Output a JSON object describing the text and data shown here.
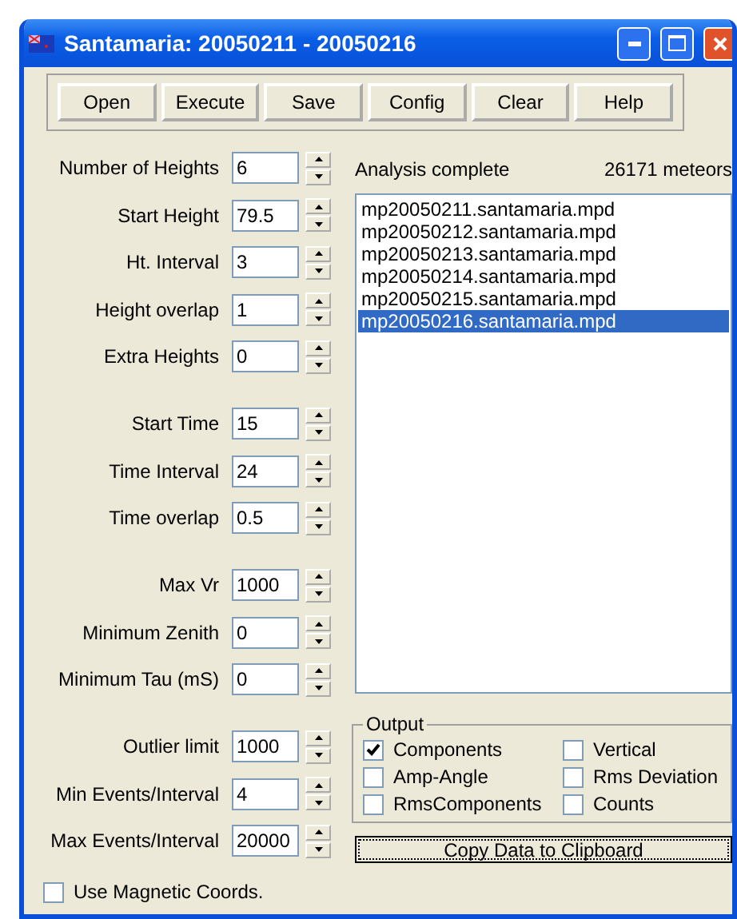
{
  "window": {
    "title": "Santamaria: 20050211 - 20050216"
  },
  "toolbar": [
    "Open",
    "Execute",
    "Save",
    "Config",
    "Clear",
    "Help"
  ],
  "parameter_groups": [
    [
      {
        "label": "Number of Heights",
        "value": "6"
      },
      {
        "label": "Start Height",
        "value": "79.5"
      },
      {
        "label": "Ht. Interval",
        "value": "3"
      },
      {
        "label": "Height overlap",
        "value": "1"
      },
      {
        "label": "Extra Heights",
        "value": "0"
      }
    ],
    [
      {
        "label": "Start Time",
        "value": "15"
      },
      {
        "label": "Time Interval",
        "value": "24"
      },
      {
        "label": "Time overlap",
        "value": "0.5"
      }
    ],
    [
      {
        "label": "Max Vr",
        "value": "1000"
      },
      {
        "label": "Minimum Zenith",
        "value": "0"
      },
      {
        "label": "Minimum Tau (mS)",
        "value": "0"
      }
    ],
    [
      {
        "label": "Outlier limit",
        "value": "1000"
      },
      {
        "label": "Min Events/Interval",
        "value": "4"
      },
      {
        "label": "Max Events/Interval",
        "value": "20000"
      }
    ]
  ],
  "use_magnetic_coords": {
    "label": "Use Magnetic Coords.",
    "checked": false
  },
  "status": {
    "message": "Analysis complete",
    "count": "26171 meteors"
  },
  "files": [
    {
      "name": "mp20050211.santamaria.mpd",
      "selected": false
    },
    {
      "name": "mp20050212.santamaria.mpd",
      "selected": false
    },
    {
      "name": "mp20050213.santamaria.mpd",
      "selected": false
    },
    {
      "name": "mp20050214.santamaria.mpd",
      "selected": false
    },
    {
      "name": "mp20050215.santamaria.mpd",
      "selected": false
    },
    {
      "name": "mp20050216.santamaria.mpd",
      "selected": true
    }
  ],
  "output": {
    "title": "Output",
    "options": [
      {
        "label": "Components",
        "checked": true
      },
      {
        "label": "Vertical",
        "checked": false
      },
      {
        "label": "Amp-Angle",
        "checked": false
      },
      {
        "label": "Rms Deviation",
        "checked": false
      },
      {
        "label": "RmsComponents",
        "checked": false
      },
      {
        "label": "Counts",
        "checked": false
      }
    ]
  },
  "copy_button": "Copy Data to Clipboard"
}
